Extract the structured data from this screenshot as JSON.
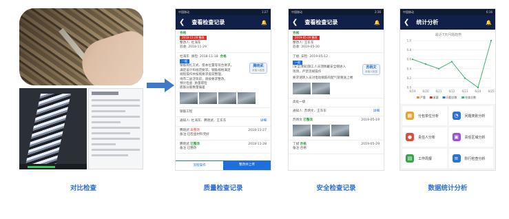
{
  "captions": {
    "comparison": "对比检查",
    "quality": "质量检查记录",
    "safety": "安全检查记录",
    "statistics": "数据统计分析"
  },
  "quality_phone": {
    "status_left": "中国移动",
    "status_right": "1:27",
    "title": "查看检查记录",
    "record1": {
      "status": "合格",
      "tag": "2018-11-28 整改",
      "line1": "整改人: 杜海东",
      "line2": "验收: 2018-11-29"
    },
    "record2": {
      "inspector": "杜海东",
      "date": "质检: 2018-11-18",
      "result": "合格",
      "tag": "一般",
      "text1": "钢筋绑扎方式、搭本位置等符合要求，",
      "text2": "满足设计和规范要求。钢筋规格满足",
      "text3": "规程操作并按照要求提前整理，",
      "text4": "待市二层浇筑前，请按要求整改。",
      "person_name": "腾晓武",
      "person_role": "对接人检查",
      "meta": "预计检查: 质量职检",
      "location": "底筋分筋数量偏差"
    },
    "section": "钢筋工程",
    "notify": "通知人: 杜海东、腾晓武、王东东",
    "detail": "详细",
    "follow1": {
      "name": "腾晓武",
      "state": "未整改",
      "date": "2018-11-27",
      "note": "备注:已检查材料完好"
    },
    "follow2": {
      "name": "腾晓武",
      "state": "已整改",
      "date": "2018-11-28",
      "note": "备注:已整改"
    },
    "tab1": "流程操作",
    "tab2": "整改并上传"
  },
  "safety_phone": {
    "status_left": "中国移动",
    "status_right": "2:36",
    "title": "查看检查记录",
    "record1": {
      "status": "合格",
      "tag": "2019-05-29 整改",
      "line1": "整改人: 王东东",
      "line2": "验收: 2019-05-30"
    },
    "record2": {
      "inspector": "丁斌",
      "date": "安检: 2019-05-12",
      "tag": "一般",
      "text1": "[安全须知]施工人员须佩戴安全帽进入",
      "text2": "现场，严禁违规操作",
      "person_name": "苏炳文",
      "person_role": "对接人检查",
      "line3": "要求请转入员对电动钢筋的配气管重送上楼"
    },
    "section": "高处一级",
    "notify": "通知人: 苏炳文、王东东",
    "detail": "详细",
    "follow1": {
      "name": "苏炳文",
      "state": "已整改",
      "date": "2019-05-19"
    },
    "follow2": {
      "name": "丁斌",
      "state": "合格",
      "date": "2019-05-29",
      "note": "备注:合格"
    }
  },
  "stats_phone": {
    "status_left": "中国移动",
    "status_right": "6:16",
    "title": "统计分析",
    "menu": [
      {
        "label": "分包单位分析",
        "icon": "building-icon",
        "color": "#f0a030"
      },
      {
        "label": "问题类别分析",
        "icon": "pie-chart-icon",
        "color": "#2a72d6"
      },
      {
        "label": "责任人分析",
        "icon": "person-icon",
        "color": "#e0483a"
      },
      {
        "label": "责任区域分析",
        "icon": "area-icon",
        "color": "#a04fd0"
      },
      {
        "label": "工作周报",
        "icon": "calendar-icon",
        "color": "#3aa34a"
      },
      {
        "label": "阶行检查分析",
        "icon": "document-icon",
        "color": "#2a72d6"
      }
    ]
  },
  "chart_data": {
    "type": "line",
    "title": "最近7天问题趋势",
    "categories": [
      "6/19",
      "6/20",
      "6/21",
      "6/22",
      "6/23",
      "6/24",
      "6/25"
    ],
    "series": [
      {
        "name": "问题趋势",
        "values": [
          0.6,
          0.5,
          0.4,
          0.55,
          0.2,
          0.0,
          1.0
        ],
        "color": "#3cb371"
      }
    ],
    "ylim": [
      0,
      1.0
    ],
    "yticks": [
      "1.0",
      "0.8",
      "0.6",
      "0.4",
      "0.2",
      "0.0"
    ],
    "legend": [
      {
        "label": "严重",
        "color": "#e8902a"
      },
      {
        "label": "紧要",
        "color": "#d9302c"
      },
      {
        "label": "问题总数",
        "color": "#2a72d6"
      },
      {
        "label": "检查总数",
        "color": "#3cb371"
      }
    ],
    "legend_position": "bottom"
  }
}
